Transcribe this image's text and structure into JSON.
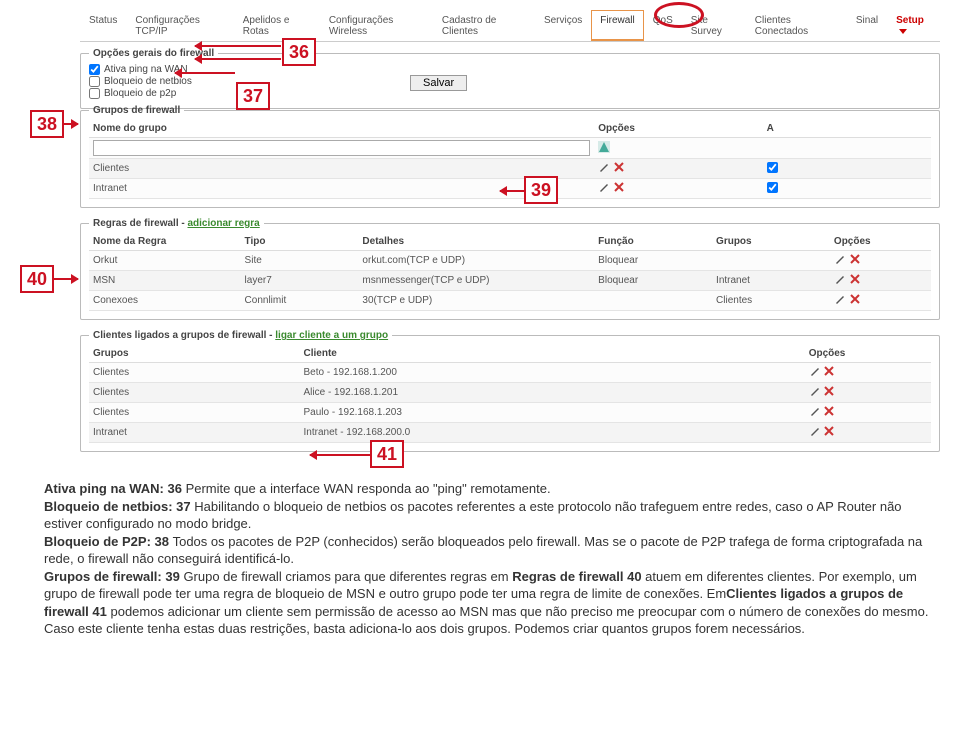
{
  "tabs": [
    "Status",
    "Configurações TCP/IP",
    "Apelidos e Rotas",
    "Configurações Wireless",
    "Cadastro de Clientes",
    "Serviços",
    "Firewall",
    "QoS",
    "Site Survey",
    "Clientes Conectados",
    "Sinal",
    "Setup"
  ],
  "general": {
    "legend": "Opções gerais do firewall",
    "opts": [
      "Ativa ping na WAN",
      "Bloqueio de netbios",
      "Bloqueio de p2p"
    ],
    "save": "Salvar"
  },
  "groups": {
    "legend": "Grupos de firewall",
    "headers": [
      "Nome do grupo",
      "Opções",
      "A"
    ],
    "rows": [
      {
        "name": "",
        "input": true,
        "opt": "add",
        "a": ""
      },
      {
        "name": "Clientes",
        "opt": "ex",
        "a": true
      },
      {
        "name": "Intranet",
        "opt": "ex",
        "a": true
      }
    ]
  },
  "rules": {
    "legend": "Regras de firewall - ",
    "legend_link": "adicionar regra",
    "headers": [
      "Nome da Regra",
      "Tipo",
      "Detalhes",
      "Função",
      "Grupos",
      "Opções"
    ],
    "rows": [
      {
        "name": "Orkut",
        "tipo": "Site",
        "det": "orkut.com(TCP e UDP)",
        "func": "Bloquear",
        "grp": ""
      },
      {
        "name": "MSN",
        "tipo": "layer7",
        "det": "msnmessenger(TCP e UDP)",
        "func": "Bloquear",
        "grp": "Intranet"
      },
      {
        "name": "Conexoes",
        "tipo": "Connlimit",
        "det": "30(TCP e UDP)",
        "func": "",
        "grp": "Clientes"
      }
    ]
  },
  "clients": {
    "legend": "Clientes ligados a grupos de firewall - ",
    "legend_link": "ligar cliente a um grupo",
    "headers": [
      "Grupos",
      "Cliente",
      "Opções"
    ],
    "rows": [
      {
        "grp": "Clientes",
        "cli": "Beto - 192.168.1.200"
      },
      {
        "grp": "Clientes",
        "cli": "Alice - 192.168.1.201"
      },
      {
        "grp": "Clientes",
        "cli": "Paulo - 192.168.1.203"
      },
      {
        "grp": "Intranet",
        "cli": "Intranet - 192.168.200.0"
      }
    ]
  },
  "callouts": {
    "c36": "36",
    "c37": "37",
    "c38": "38",
    "c39": "39",
    "c40": "40",
    "c41": "41"
  },
  "text": {
    "p1a": "Ativa ping na WAN: 36 ",
    "p1b": "Permite que a interface WAN responda ao \"ping\" remotamente.",
    "p2a": "Bloqueio de netbios: 37 ",
    "p2b": "Habilitando o bloqueio de netbios os pacotes referentes a este protocolo não trafeguem entre redes, caso o AP Router não estiver configurado no modo bridge.",
    "p3a": "Bloqueio de P2P: 38 ",
    "p3b": "Todos os pacotes de P2P (conhecidos) serão bloqueados pelo firewall. Mas se o pacote de P2P trafega de forma criptografada na rede, o firewall não conseguirá identificá-lo.",
    "p4a": "Grupos de firewall: 39 ",
    "p4b": "Grupo de firewall criamos para que diferentes regras em ",
    "p4c": "Regras de firewall 40",
    "p4d": " atuem em diferentes clientes. Por exemplo, um grupo de firewall pode ter uma regra de bloqueio de MSN e outro grupo pode ter uma regra de limite de conexões. Em",
    "p4e": "Clientes ligados a grupos de firewall 41",
    "p4f": " podemos adicionar um cliente sem permissão de acesso ao MSN mas que não preciso me preocupar com o número de conexões do mesmo. Caso este cliente tenha estas duas restrições, basta adiciona-lo aos dois grupos. Podemos criar quantos grupos forem necessários."
  }
}
